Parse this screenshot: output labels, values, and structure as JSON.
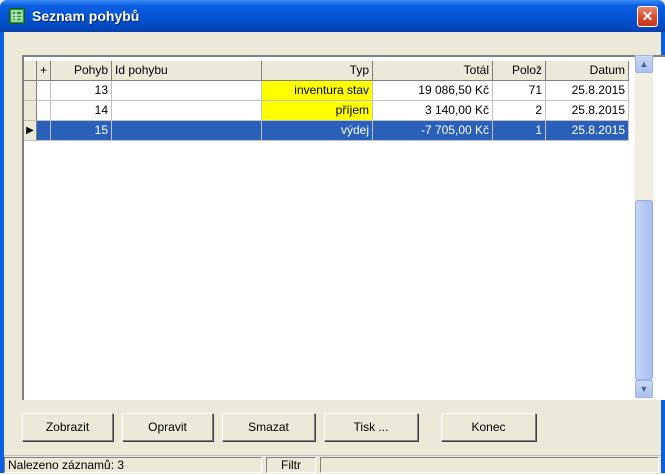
{
  "window": {
    "title": "Seznam pohybů",
    "close_glyph": "✕",
    "icon": "table-icon"
  },
  "grid": {
    "columns": [
      "+",
      "Pohyb",
      "Id pohybu",
      "Typ",
      "Totál",
      "Polož",
      "Datum"
    ],
    "rows": [
      {
        "pohyb": "13",
        "id_pohybu": "",
        "typ": "inventura stav",
        "total": "19 086,50 Kč",
        "poloz": "71",
        "datum": "25.8.2015",
        "selected": false
      },
      {
        "pohyb": "14",
        "id_pohybu": "",
        "typ": "příjem",
        "total": "3 140,00 Kč",
        "poloz": "2",
        "datum": "25.8.2015",
        "selected": false
      },
      {
        "pohyb": "15",
        "id_pohybu": "",
        "typ": "výdej",
        "total": "-7 705,00 Kč",
        "poloz": "1",
        "datum": "25.8.2015",
        "selected": true
      }
    ],
    "current_row_marker": "▶"
  },
  "scrollbar": {
    "up_glyph": "▲",
    "down_glyph": "▼"
  },
  "buttons": {
    "zobrazit": "Zobrazit",
    "opravit": "Opravit",
    "smazat": "Smazat",
    "tisk": "Tisk ...",
    "konec": "Konec"
  },
  "status": {
    "count_text": "Nalezeno záznamů: 3",
    "filter_label": "Filtr"
  },
  "colors": {
    "titlebar": "#0355d6",
    "selection": "#2a5fba",
    "highlight": "#ffff00"
  }
}
